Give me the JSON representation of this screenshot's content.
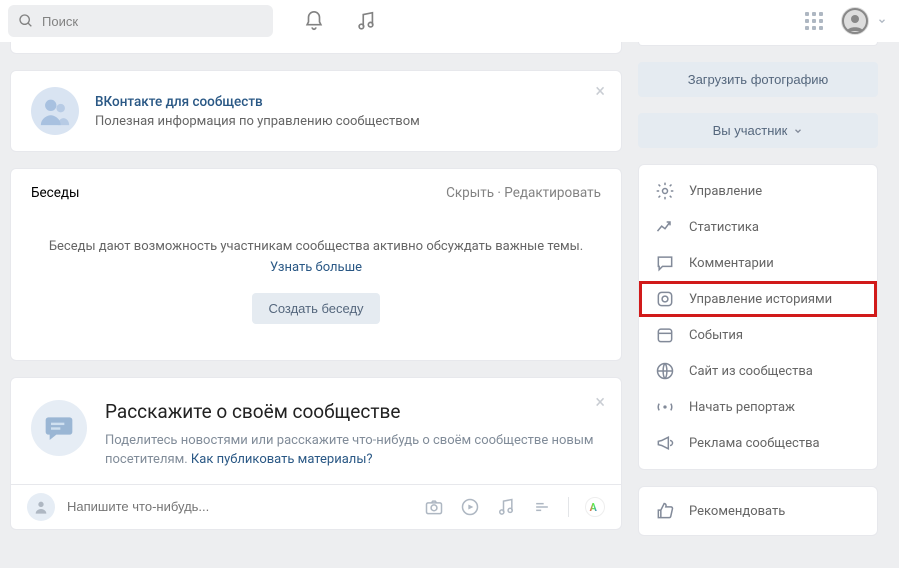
{
  "header": {
    "search_placeholder": "Поиск"
  },
  "promo": {
    "title": "ВКонтакте для сообществ",
    "subtitle": "Полезная информация по управлению сообществом"
  },
  "besedy": {
    "title": "Беседы",
    "hide": "Скрыть",
    "edit": "Редактировать",
    "body_text": "Беседы дают возможность участникам сообщества активно обсуждать важные темы. ",
    "more": "Узнать больше",
    "create_btn": "Создать беседу"
  },
  "about": {
    "title": "Расскажите о своём сообществе",
    "line1": "Поделитесь новостями или расскажите что-нибудь о своём сообществе новым посетителям. ",
    "link": "Как публиковать материалы?"
  },
  "compose": {
    "placeholder": "Напишите что-нибудь..."
  },
  "sidebar": {
    "upload_btn": "Загрузить фотографию",
    "member_btn": "Вы участник",
    "items": [
      {
        "label": "Управление"
      },
      {
        "label": "Статистика"
      },
      {
        "label": "Комментарии"
      },
      {
        "label": "Управление историями"
      },
      {
        "label": "События"
      },
      {
        "label": "Сайт из сообщества"
      },
      {
        "label": "Начать репортаж"
      },
      {
        "label": "Реклама сообщества"
      },
      {
        "label": "Рекомендовать"
      }
    ]
  }
}
